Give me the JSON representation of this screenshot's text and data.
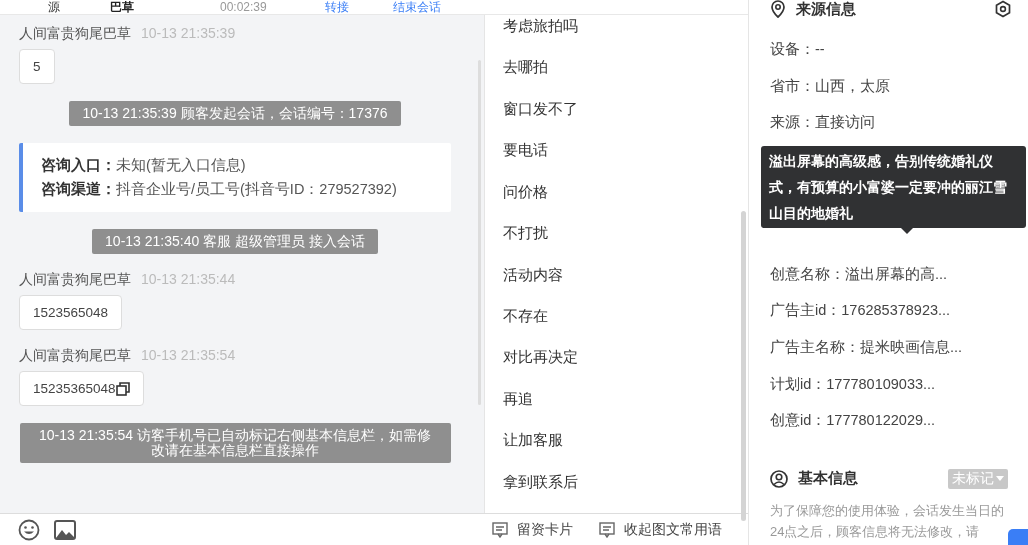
{
  "header": {
    "items": [
      {
        "kind": "text",
        "text": "源"
      },
      {
        "kind": "name",
        "text": "巴草"
      },
      {
        "kind": "timer",
        "text": "00:02:39"
      },
      {
        "kind": "link",
        "text": "转接"
      },
      {
        "kind": "link",
        "text": "结束会话"
      }
    ]
  },
  "chat": {
    "messages": [
      {
        "kind": "visitor",
        "sender": "人间富贵狗尾巴草",
        "time": "10-13 21:35:39",
        "text": "5",
        "copy": false
      },
      {
        "kind": "system",
        "text": "10-13 21:35:39 顾客发起会话，会话编号：17376"
      },
      {
        "kind": "info",
        "fields": [
          {
            "label": "咨询入口：",
            "value": "未知(暂无入口信息)"
          },
          {
            "label": "咨询渠道：",
            "value": "抖音企业号/员工号(抖音号ID：279527392)"
          }
        ]
      },
      {
        "kind": "system",
        "text": "10-13 21:35:40 客服 超级管理员 接入会话"
      },
      {
        "kind": "visitor",
        "sender": "人间富贵狗尾巴草",
        "time": "10-13 21:35:44",
        "text": "1523565048",
        "copy": false
      },
      {
        "kind": "visitor",
        "sender": "人间富贵狗尾巴草",
        "time": "10-13 21:35:54",
        "text": "15235365048",
        "copy": true
      },
      {
        "kind": "system",
        "text": "10-13 21:35:54 访客手机号已自动标记右侧基本信息栏，如需修改请在基本信息栏直接操作"
      }
    ]
  },
  "phrases": [
    "考虑旅拍吗",
    "去哪拍",
    "窗口发不了",
    "要电话",
    "问价格",
    "不打扰",
    "活动内容",
    "不存在",
    "对比再决定",
    "再追",
    "让加客服",
    "拿到联系后"
  ],
  "toolbar": {
    "actions": [
      "留资卡片",
      "收起图文常用语"
    ]
  },
  "source_info": {
    "title": "来源信息",
    "rows": [
      "设备：--",
      "省市：山西，太原",
      "来源：直接访问",
      "创意名称：溢出屏幕的高...",
      "广告主id：176285378923...",
      "广告主名称：提米映画信息...",
      "计划id：177780109033...",
      "创意id：177780122029..."
    ]
  },
  "tooltip": {
    "text": "溢出屏幕的高级感，告别传统婚礼仪式，有预算的小富婆一定要冲的丽江雪山目的地婚礼"
  },
  "basic_info": {
    "title": "基本信息",
    "tag": "未标记",
    "note": "为了保障您的使用体验，会话发生当日的24点之后，顾客信息将无法修改，请"
  }
}
